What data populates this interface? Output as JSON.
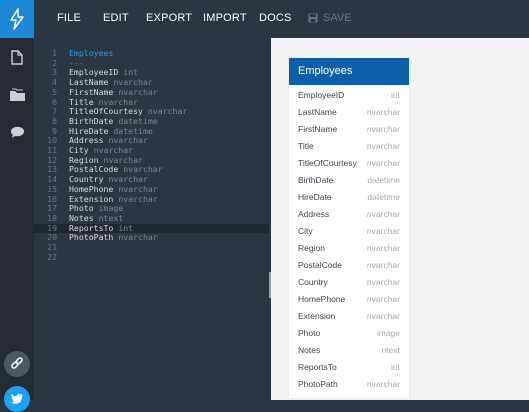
{
  "menu": {
    "file": "FILE",
    "edit": "EDIT",
    "export": "EXPORT",
    "import": "IMPORT",
    "docs": "DOCS",
    "save": "SAVE"
  },
  "rail_icons": [
    "logo-icon",
    "document-icon",
    "folder-icon",
    "chat-icon",
    "link-icon",
    "twitter-icon"
  ],
  "editor": {
    "lines": [
      {
        "n": "1",
        "name": "Employees",
        "type": ""
      },
      {
        "n": "2",
        "name": "---",
        "type": ""
      },
      {
        "n": "3",
        "name": "EmployeeID",
        "type": "int"
      },
      {
        "n": "4",
        "name": "LastName",
        "type": "nvarchar"
      },
      {
        "n": "5",
        "name": "FirstName",
        "type": "nvarchar"
      },
      {
        "n": "6",
        "name": "Title",
        "type": "nvarchar"
      },
      {
        "n": "7",
        "name": "TitleOfCourtesy",
        "type": "nvarchar"
      },
      {
        "n": "8",
        "name": "BirthDate",
        "type": "datetime"
      },
      {
        "n": "9",
        "name": "HireDate",
        "type": "datetime"
      },
      {
        "n": "10",
        "name": "Address",
        "type": "nvarchar"
      },
      {
        "n": "11",
        "name": "City",
        "type": "nvarchar"
      },
      {
        "n": "12",
        "name": "Region",
        "type": "nvarchar"
      },
      {
        "n": "13",
        "name": "PostalCode",
        "type": "nvarchar"
      },
      {
        "n": "14",
        "name": "Country",
        "type": "nvarchar"
      },
      {
        "n": "15",
        "name": "HomePhone",
        "type": "nvarchar"
      },
      {
        "n": "16",
        "name": "Extension",
        "type": "nvarchar"
      },
      {
        "n": "17",
        "name": "Photo",
        "type": "image"
      },
      {
        "n": "18",
        "name": "Notes",
        "type": "ntext"
      },
      {
        "n": "19",
        "name": "ReportsTo",
        "type": "int"
      },
      {
        "n": "20",
        "name": "PhotoPath",
        "type": "nvarchar"
      },
      {
        "n": "21",
        "name": "",
        "type": ""
      },
      {
        "n": "22",
        "name": "",
        "type": ""
      }
    ],
    "active_line": "19"
  },
  "diagram": {
    "table_name": "Employees",
    "fields": [
      {
        "name": "EmployeeID",
        "type": "int"
      },
      {
        "name": "LastName",
        "type": "nvarchar"
      },
      {
        "name": "FirstName",
        "type": "nvarchar"
      },
      {
        "name": "Title",
        "type": "nvarchar"
      },
      {
        "name": "TitleOfCourtesy",
        "type": "nvarchar"
      },
      {
        "name": "BirthDate",
        "type": "datetime"
      },
      {
        "name": "HireDate",
        "type": "datetime"
      },
      {
        "name": "Address",
        "type": "nvarchar"
      },
      {
        "name": "City",
        "type": "nvarchar"
      },
      {
        "name": "Region",
        "type": "nvarchar"
      },
      {
        "name": "PostalCode",
        "type": "nvarchar"
      },
      {
        "name": "Country",
        "type": "nvarchar"
      },
      {
        "name": "HomePhone",
        "type": "nvarchar"
      },
      {
        "name": "Extension",
        "type": "nvarchar"
      },
      {
        "name": "Photo",
        "type": "image"
      },
      {
        "name": "Notes",
        "type": "ntext"
      },
      {
        "name": "ReportsTo",
        "type": "int"
      },
      {
        "name": "PhotoPath",
        "type": "nvarchar"
      }
    ]
  },
  "colors": {
    "accent": "#1e87d8",
    "table_header": "#0c5fa8",
    "editor_bg": "#2a3642",
    "twitter": "#1da1f2"
  }
}
